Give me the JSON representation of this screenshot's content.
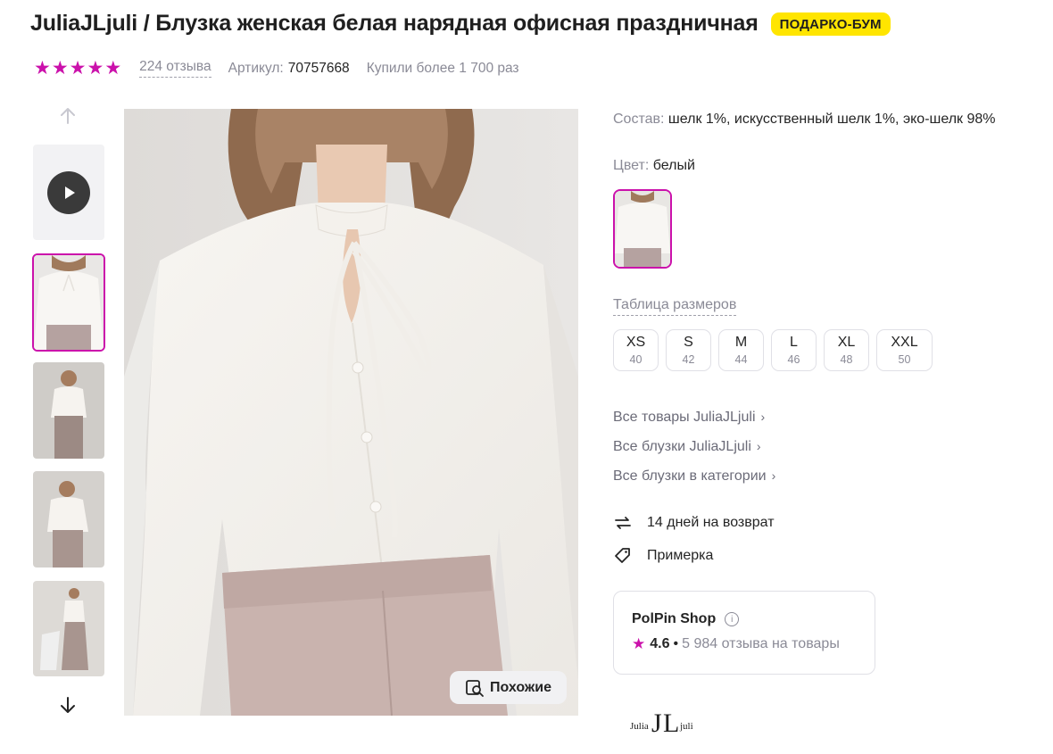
{
  "product": {
    "title": "JuliaJLjuli / Блузка женская белая нарядная офисная праздничная",
    "promo_badge": "ПОДАРКО-БУМ",
    "rating_stars": 5,
    "reviews_text": "224 отзыва",
    "article_label": "Артикул:",
    "article_value": "70757668",
    "bought_text": "Купили более 1 700 раз"
  },
  "gallery": {
    "thumbnails": [
      "play-video",
      "photo-1",
      "photo-2",
      "photo-3",
      "photo-4"
    ],
    "similar_label": "Похожие"
  },
  "details": {
    "composition_label": "Состав:",
    "composition_value": "шелк 1%, искусственный шелк 1%, эко-шелк 98%",
    "color_label": "Цвет:",
    "color_value": "белый",
    "size_table_label": "Таблица размеров",
    "sizes": [
      {
        "name": "XS",
        "num": "40"
      },
      {
        "name": "S",
        "num": "42"
      },
      {
        "name": "M",
        "num": "44"
      },
      {
        "name": "L",
        "num": "46"
      },
      {
        "name": "XL",
        "num": "48"
      },
      {
        "name": "XXL",
        "num": "50"
      }
    ],
    "links": [
      "Все товары JuliaJLjuli",
      "Все блузки JuliaJLjuli",
      "Все блузки в категории"
    ],
    "return_text": "14 дней на возврат",
    "fitting_text": "Примерка"
  },
  "shop": {
    "name": "PolPin Shop",
    "rating": "4.6",
    "reviews": "5 984 отзыва на товары"
  },
  "brand_logo": "JuliaJLjuli",
  "colors": {
    "accent": "#cb11ab",
    "badge": "#ffe500",
    "grey_text": "#8a8a96"
  }
}
